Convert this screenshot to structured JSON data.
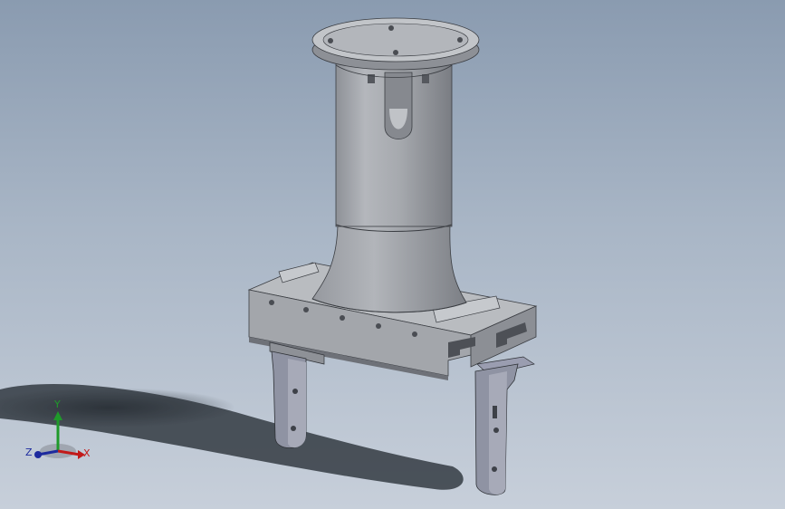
{
  "viewport": {
    "background_top": "#8a9bb0",
    "background_bottom": "#c7cfda",
    "part_color": "#a9acb1",
    "part_shadow_color": "#6e7178"
  },
  "triad": {
    "x_label": "X",
    "y_label": "Y",
    "z_label": "Z",
    "x_color": "#c21a1a",
    "y_color": "#1f9a2a",
    "z_color": "#1d2a9e"
  }
}
